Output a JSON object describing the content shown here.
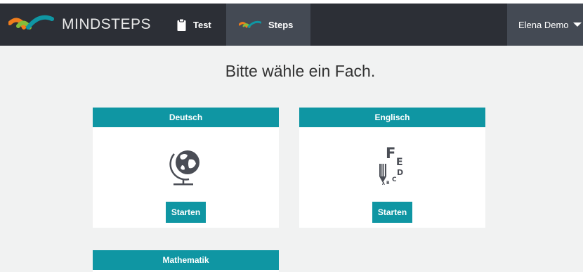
{
  "navbar": {
    "brand": "MINDSTEPS",
    "items": [
      {
        "label": "Test",
        "icon": "clipboard-icon"
      },
      {
        "label": "Steps",
        "icon": "mindsteps-logo-icon"
      }
    ],
    "user": {
      "label": "Elena Demo",
      "icon": "caret-down-icon"
    }
  },
  "main": {
    "title": "Bitte wähle ein Fach.",
    "subjects": [
      {
        "name": "Deutsch",
        "icon": "globe-icon",
        "button": "Starten"
      },
      {
        "name": "Englisch",
        "icon": "letters-pencil-icon",
        "button": "Starten"
      },
      {
        "name": "Mathematik"
      }
    ]
  },
  "colors": {
    "navbar": "#2c2f36",
    "nav_active": "#444a54",
    "accent": "#0f96a3",
    "page_background": "#f1f2f2",
    "logo_orange": "#f07d1c",
    "logo_green": "#83bd3b",
    "logo_teal": "#0f96a3"
  }
}
